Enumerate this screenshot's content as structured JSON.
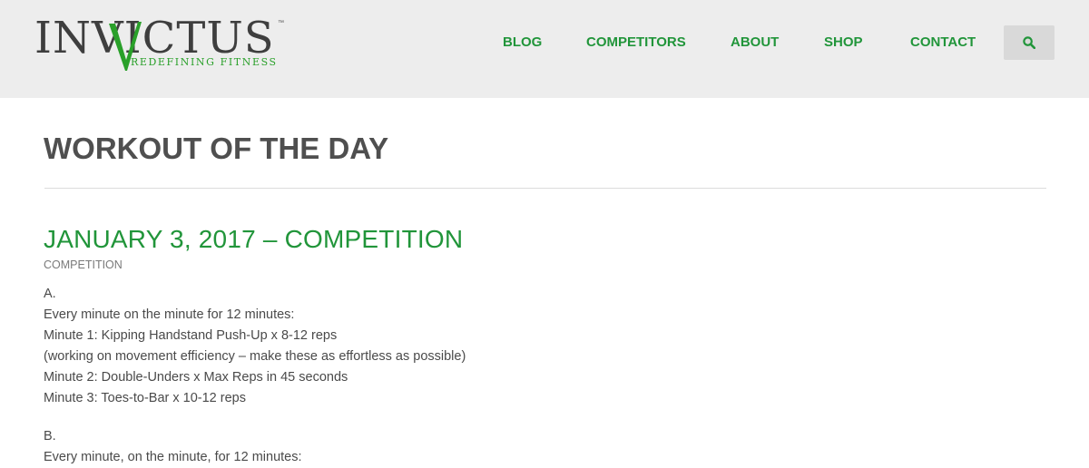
{
  "brand": {
    "name": "INVICTUS",
    "tagline": "REDEFINING FITNESS",
    "trademark": "™",
    "accent_color": "#21953a"
  },
  "nav": {
    "items": [
      {
        "label": "BLOG"
      },
      {
        "label": "COMPETITORS"
      },
      {
        "label": "ABOUT"
      },
      {
        "label": "SHOP"
      },
      {
        "label": "CONTACT"
      }
    ],
    "search_icon": "search-icon"
  },
  "page": {
    "title": "WORKOUT OF THE DAY"
  },
  "post": {
    "title": "JANUARY 3, 2017 – COMPETITION",
    "category": "COMPETITION",
    "section_a": {
      "label": "A.",
      "lines": [
        "Every minute on the minute for 12 minutes:",
        "Minute 1: Kipping Handstand Push-Up x 8-12 reps",
        "(working on movement efficiency – make these as effortless as possible)",
        "Minute 2: Double-Unders x Max Reps in 45 seconds",
        "Minute 3: Toes-to-Bar x 10-12 reps"
      ]
    },
    "section_b": {
      "label": "B.",
      "lines": [
        "Every minute, on the minute, for 12 minutes:"
      ]
    }
  }
}
